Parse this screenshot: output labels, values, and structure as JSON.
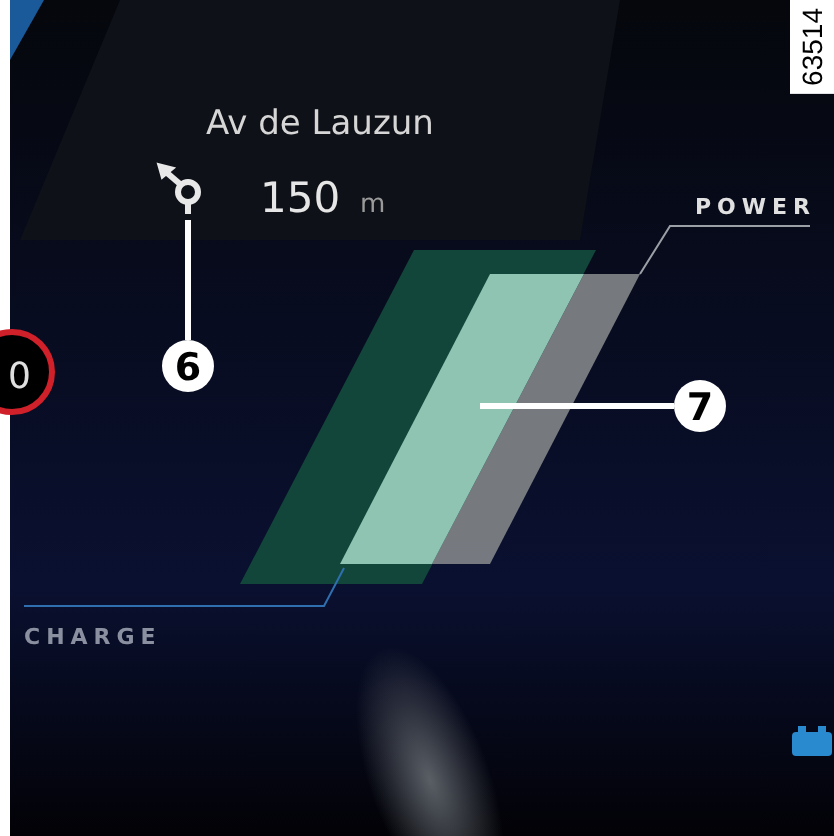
{
  "figure_number": "63514",
  "navigation": {
    "street": "Av de Lauzun",
    "distance": "150",
    "unit": "m"
  },
  "speed_limit": {
    "value": "0"
  },
  "power_gauge": {
    "power_label": "POWER",
    "charge_label": "CHARGE"
  },
  "callouts": [
    {
      "number": "6"
    },
    {
      "number": "7"
    }
  ]
}
